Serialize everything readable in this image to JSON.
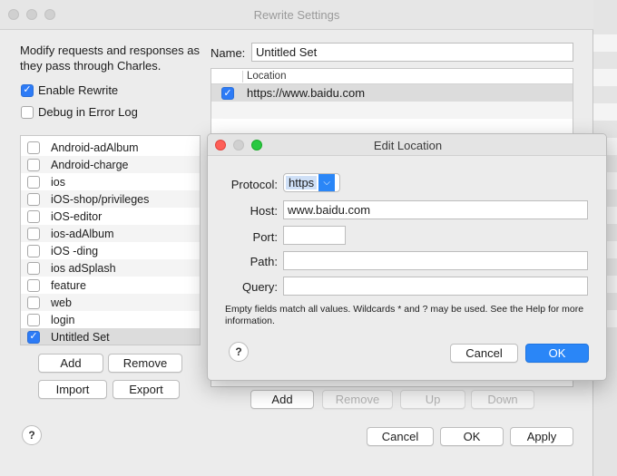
{
  "main_window": {
    "title": "Rewrite Settings",
    "description": "Modify requests and responses as they pass through Charles.",
    "enable_rewrite": {
      "label": "Enable Rewrite",
      "checked": true
    },
    "debug_error_log": {
      "label": "Debug in Error Log",
      "checked": false
    },
    "sets": [
      {
        "label": "Android-adAlbum",
        "checked": false
      },
      {
        "label": "Android-charge",
        "checked": false
      },
      {
        "label": "ios",
        "checked": false
      },
      {
        "label": "iOS-shop/privileges",
        "checked": false
      },
      {
        "label": "iOS-editor",
        "checked": false
      },
      {
        "label": "ios-adAlbum",
        "checked": false
      },
      {
        "label": "iOS -ding",
        "checked": false
      },
      {
        "label": "ios adSplash",
        "checked": false
      },
      {
        "label": "feature",
        "checked": false
      },
      {
        "label": "web",
        "checked": false
      },
      {
        "label": "login",
        "checked": false
      },
      {
        "label": "Untitled Set",
        "checked": true
      }
    ],
    "set_buttons": {
      "add": "Add",
      "remove": "Remove",
      "import": "Import",
      "export": "Export"
    },
    "name_label": "Name:",
    "name_value": "Untitled Set",
    "location_header": "Location",
    "locations": [
      {
        "label": "https://www.baidu.com",
        "checked": true
      }
    ],
    "rule_buttons": {
      "add": "Add",
      "remove": "Remove",
      "up": "Up",
      "down": "Down"
    },
    "help": "?",
    "footer_buttons": {
      "cancel": "Cancel",
      "ok": "OK",
      "apply": "Apply"
    }
  },
  "edit_location": {
    "title": "Edit Location",
    "protocol_label": "Protocol:",
    "protocol_value": "https",
    "host_label": "Host:",
    "host_value": "www.baidu.com",
    "port_label": "Port:",
    "port_value": "",
    "path_label": "Path:",
    "path_value": "",
    "query_label": "Query:",
    "query_value": "",
    "hint": "Empty fields match all values. Wildcards * and ? may be used. See the Help for more information.",
    "help": "?",
    "cancel": "Cancel",
    "ok": "OK"
  },
  "colors": {
    "accent": "#2a86f7",
    "close": "#fe5f57",
    "minimize": "#febc2e",
    "zoom": "#28c840"
  }
}
